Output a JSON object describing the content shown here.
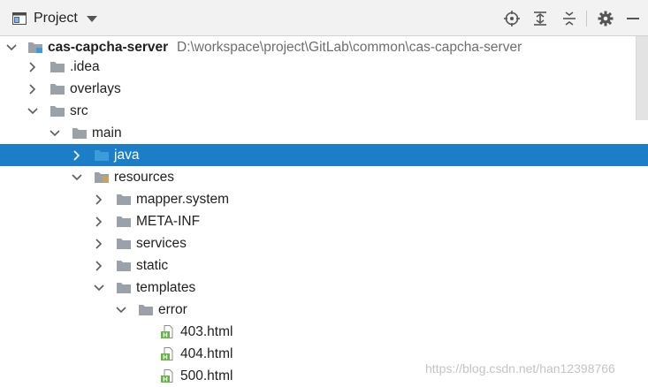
{
  "toolbar": {
    "title": "Project",
    "icons": [
      "project-view-icon",
      "chevron-down-icon",
      "locate-icon",
      "expand-all-icon",
      "collapse-all-icon",
      "gear-icon",
      "minimize-icon"
    ]
  },
  "tree": {
    "root": {
      "label": "cas-capcha-server",
      "path": "D:\\workspace\\project\\GitLab\\common\\cas-capcha-server"
    },
    "idea": ".idea",
    "overlays": "overlays",
    "src": "src",
    "main": "main",
    "java": "java",
    "resources": "resources",
    "mapper_system": "mapper.system",
    "meta_inf": "META-INF",
    "services": "services",
    "static": "static",
    "templates": "templates",
    "error": "error",
    "file_403": "403.html",
    "file_404": "404.html",
    "file_500": "500.html"
  },
  "selected_item": "java",
  "colors": {
    "selection": "#1c7ec8",
    "folder": "#9aa1a9",
    "source_folder": "#3e9bd9",
    "html_badge": "#62b543"
  },
  "watermark": "https://blog.csdn.net/han12398766"
}
